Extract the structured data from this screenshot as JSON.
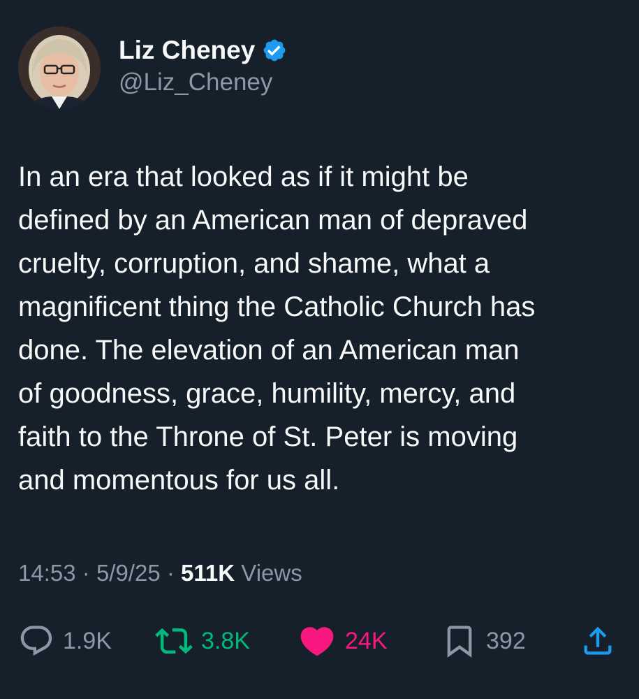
{
  "author": {
    "display_name": "Liz Cheney",
    "handle": "@Liz_Cheney",
    "verified": true
  },
  "tweet": {
    "lines": [
      "In an era that looked as if it might be",
      "defined by an American man of depraved",
      "cruelty, corruption, and shame, what a",
      "magnificent thing the Catholic Church has",
      "done. The elevation of an American man",
      "of goodness, grace, humility, mercy, and",
      "faith to the Throne of St. Peter is moving",
      "and momentous for us all."
    ]
  },
  "meta": {
    "time": "14:53",
    "separator": "·",
    "date": "5/9/25",
    "views_count": "511K",
    "views_label": "Views"
  },
  "actions": {
    "replies": "1.9K",
    "retweets": "3.8K",
    "likes": "24K",
    "bookmarks": "392"
  },
  "colors": {
    "background": "#15202b",
    "text": "#f7f9f9",
    "muted": "#8b98a5",
    "verified": "#1d9bf0",
    "retweet": "#00ba7c",
    "like": "#f91880"
  },
  "icons": {
    "reply": "speech-bubble-icon",
    "retweet": "retweet-arrows-icon",
    "like": "heart-icon",
    "bookmark": "bookmark-icon",
    "share": "upload-share-icon",
    "verified": "verified-badge-icon"
  }
}
